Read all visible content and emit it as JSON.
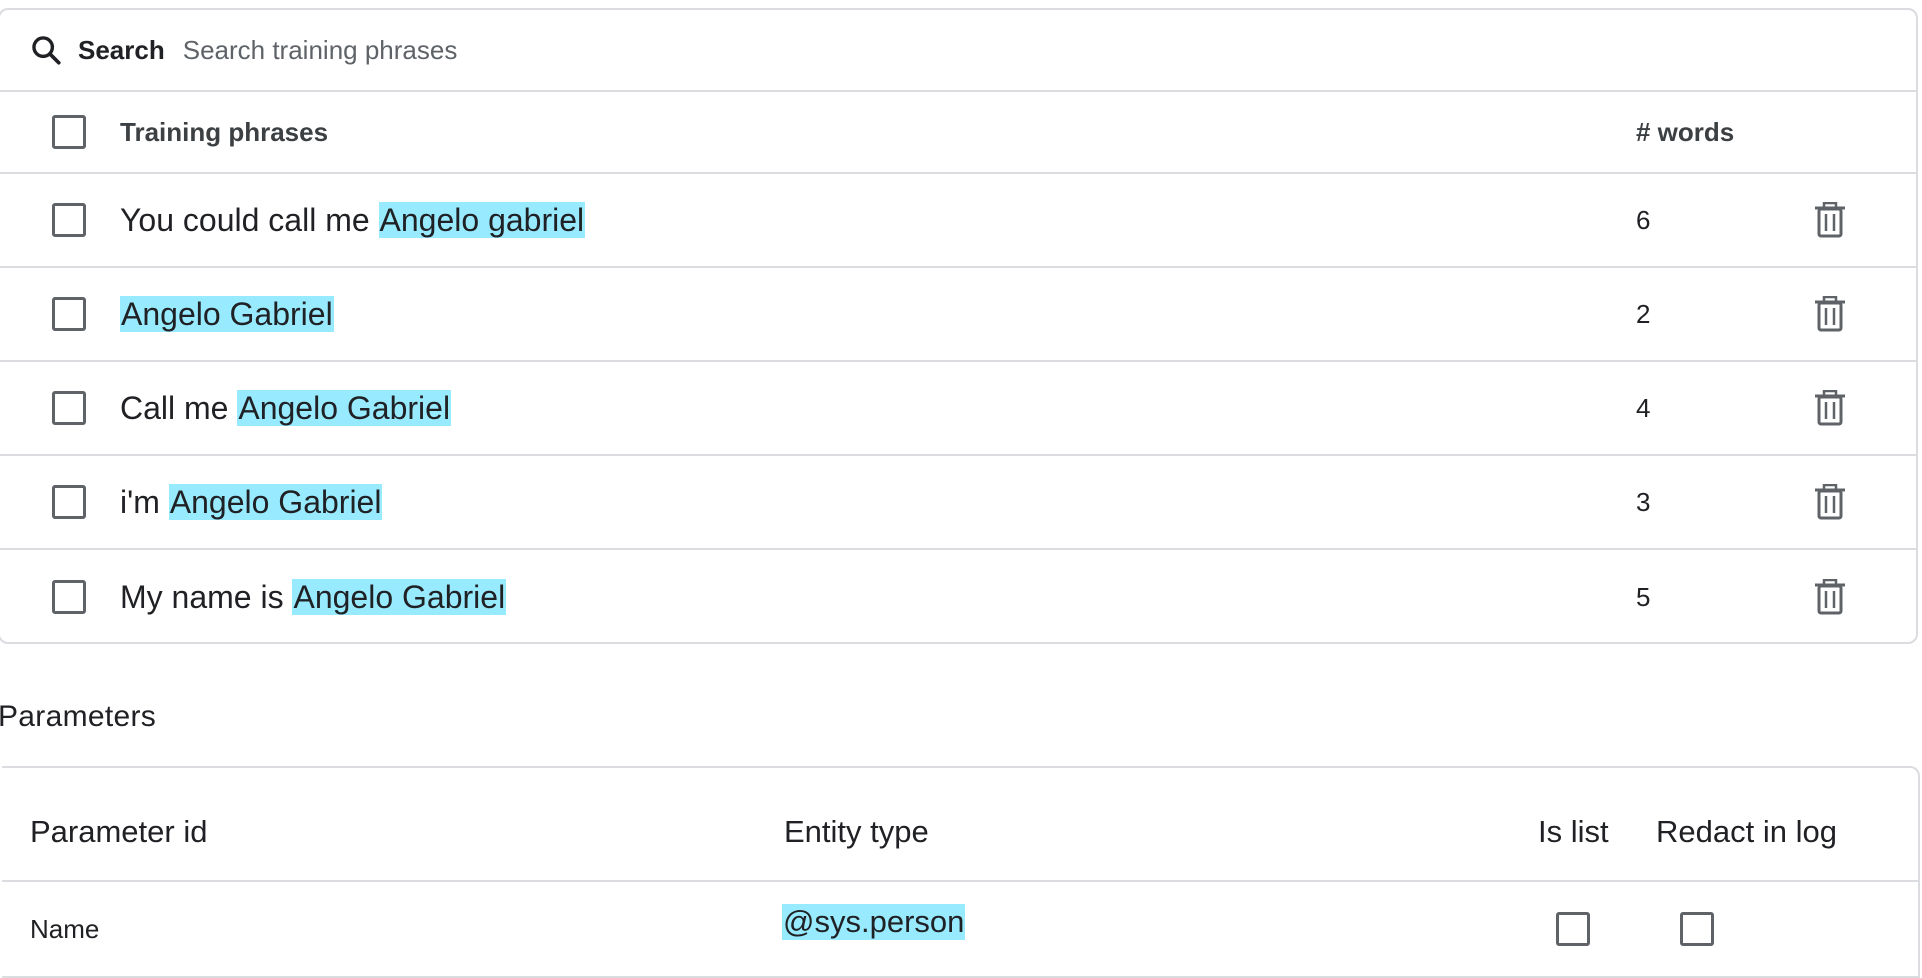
{
  "search": {
    "label": "Search",
    "placeholder": "Search training phrases",
    "value": ""
  },
  "training_table": {
    "header": {
      "phrases_label": "Training phrases",
      "words_label": "# words"
    },
    "rows": [
      {
        "prefix": "You could call me ",
        "entity": "Angelo gabriel",
        "words": "6"
      },
      {
        "prefix": "",
        "entity": "Angelo Gabriel",
        "words": "2"
      },
      {
        "prefix": "Call me ",
        "entity": "Angelo Gabriel",
        "words": "4"
      },
      {
        "prefix": "i'm ",
        "entity": "Angelo Gabriel",
        "words": "3"
      },
      {
        "prefix": "My name is ",
        "entity": "Angelo Gabriel",
        "words": "5"
      }
    ]
  },
  "parameters": {
    "title": "Parameters",
    "columns": {
      "id": "Parameter id",
      "entity_type": "Entity type",
      "is_list": "Is list",
      "redact": "Redact in log"
    },
    "rows": [
      {
        "id": "Name",
        "entity_type": "@sys.person",
        "is_list": false,
        "redact": false
      }
    ]
  },
  "colors": {
    "highlight": "#98eaff",
    "border": "#dadce0",
    "checkbox": "#5f6368",
    "text": "#202124"
  },
  "icons": {
    "search": "search-icon",
    "delete": "trash-icon"
  }
}
